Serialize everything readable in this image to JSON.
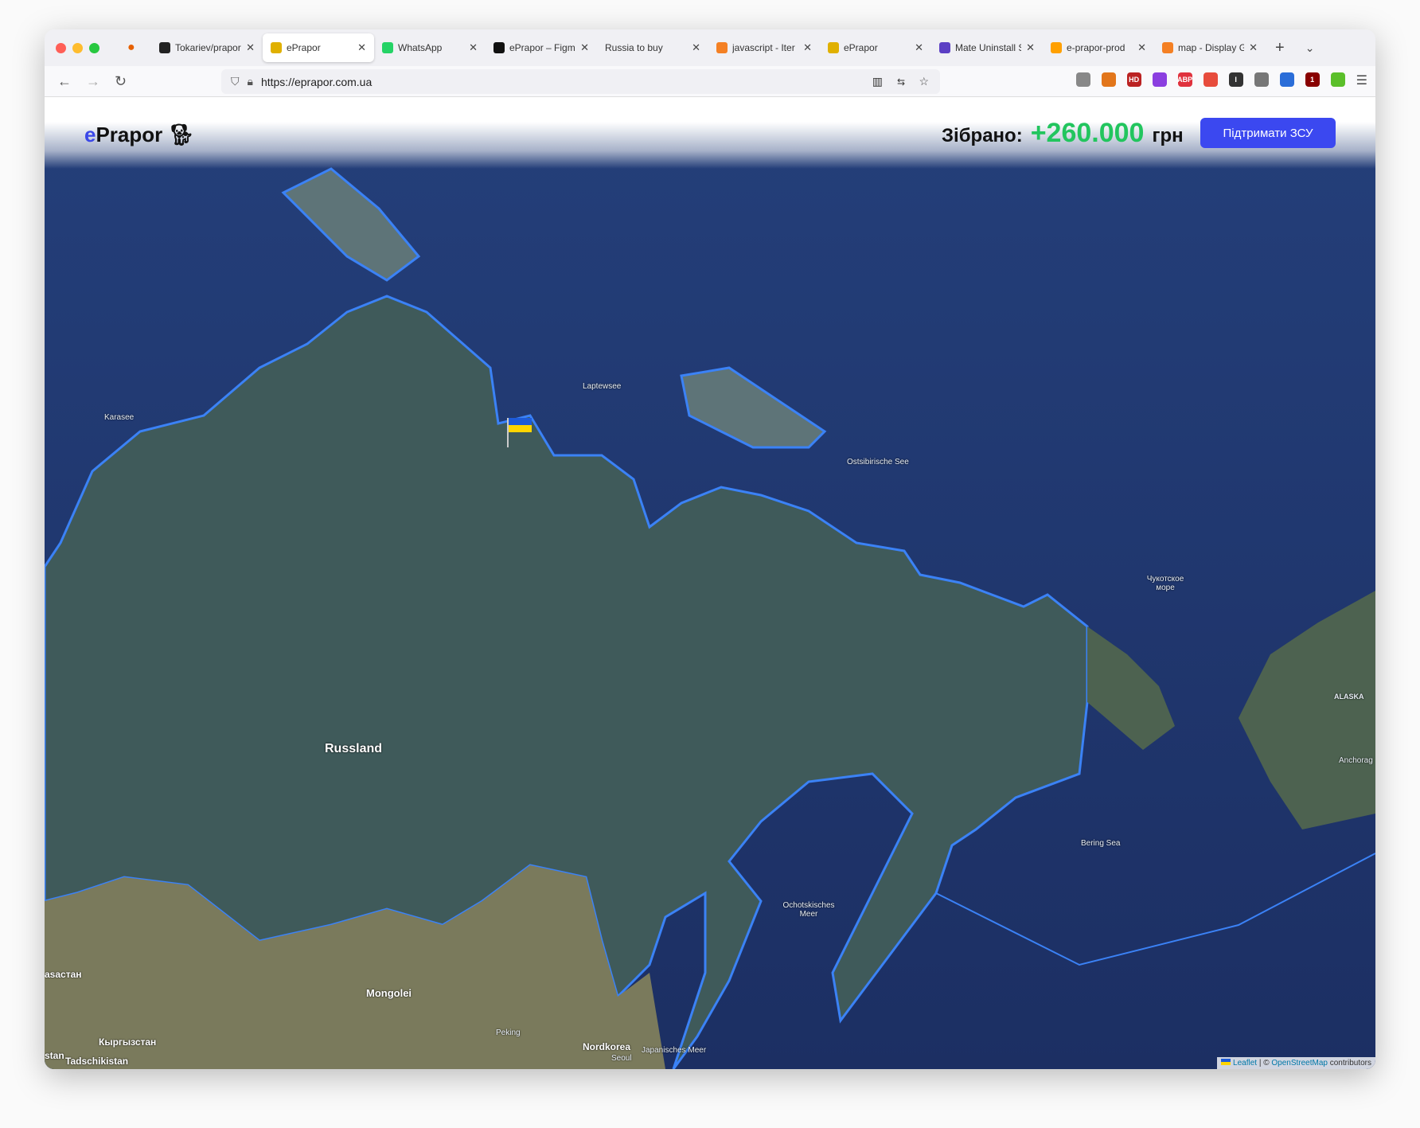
{
  "browser": {
    "tabs": [
      {
        "title": "Tokariev/prapor",
        "icon": "github-icon",
        "color": "#222"
      },
      {
        "title": "ePrapor",
        "icon": "eprapor-icon",
        "color": "#e0b000",
        "active": true
      },
      {
        "title": "WhatsApp",
        "icon": "whatsapp-icon",
        "color": "#25d366"
      },
      {
        "title": "ePrapor – Figma",
        "icon": "figma-icon",
        "color": "#111"
      },
      {
        "title": "Russia to buy",
        "icon": "",
        "color": ""
      },
      {
        "title": "javascript - Iter",
        "icon": "stackoverflow-icon",
        "color": "#f48024"
      },
      {
        "title": "ePrapor",
        "icon": "eprapor-icon",
        "color": "#e0b000"
      },
      {
        "title": "Mate Uninstall S",
        "icon": "mate-icon",
        "color": "#5b3fc4"
      },
      {
        "title": "e-prapor-prod",
        "icon": "firebase-icon",
        "color": "#ffa000"
      },
      {
        "title": "map - Display G",
        "icon": "stackoverflow-icon",
        "color": "#f48024"
      }
    ],
    "url": "https://eprapor.com.ua",
    "extensions": [
      {
        "name": "pocket-icon",
        "color": "#888",
        "label": ""
      },
      {
        "name": "metamask-icon",
        "color": "#e2761b",
        "label": ""
      },
      {
        "name": "hd-icon",
        "color": "#b22",
        "label": "HD"
      },
      {
        "name": "purple-ext-icon",
        "color": "#8b3fe0",
        "label": ""
      },
      {
        "name": "adblock-icon",
        "color": "#e0323d",
        "label": "ABP"
      },
      {
        "name": "camera-ext-icon",
        "color": "#e74c3c",
        "label": ""
      },
      {
        "name": "text-cursor-icon",
        "color": "#333",
        "label": "I"
      },
      {
        "name": "cloud-icon",
        "color": "#777",
        "label": ""
      },
      {
        "name": "blue-ext-icon",
        "color": "#2a6dd8",
        "label": ""
      },
      {
        "name": "ublock-icon",
        "color": "#800",
        "label": "1"
      },
      {
        "name": "download-icon",
        "color": "#5bbf2a",
        "label": ""
      }
    ]
  },
  "header": {
    "logo_prefix": "e",
    "logo_rest": "Prapor",
    "collected_label": "Зібрано:",
    "collected_value": "+260.000",
    "currency": "грн",
    "support_button": "Підтримати ЗСУ"
  },
  "map": {
    "labels": {
      "laptev": "Laptewsee",
      "kara": "Karasee",
      "eastsib": "Ostsibirische See",
      "chukchi": "Чукотское море",
      "alaska": "ALASKA",
      "anchorage": "Anchorag",
      "russia": "Russland",
      "bering": "Bering Sea",
      "okhotsk": "Ochotskisches Meer",
      "mongolia": "Mongolei",
      "kazakh": "asacтан",
      "stan": "stan",
      "kyrgyz": "Кыргызстан",
      "tajik": "Tadschikistan",
      "peking": "Peking",
      "nkorea": "Nordkorea",
      "seoul": "Seoul",
      "japan": "Japanisches Meer"
    },
    "border_color": "#3b82f6",
    "attribution": {
      "leaflet": "Leaflet",
      "sep": "| ©",
      "osm": "OpenStreetMap",
      "rest": "contributors"
    }
  }
}
